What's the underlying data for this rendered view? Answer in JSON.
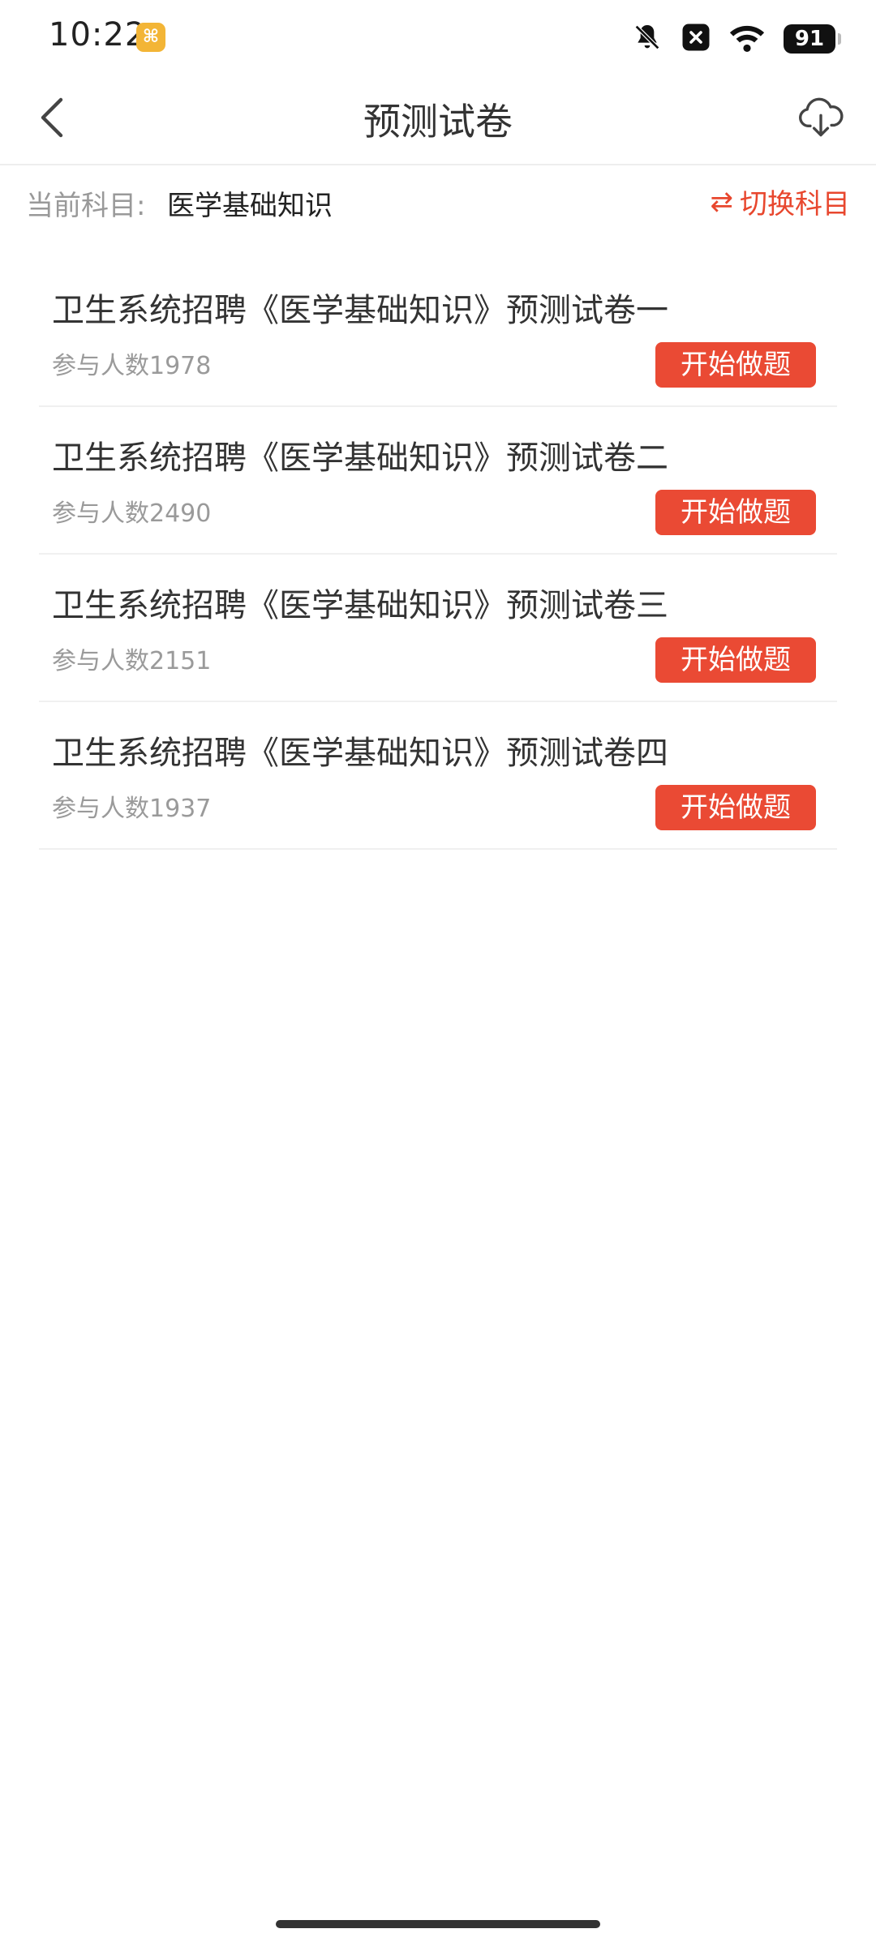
{
  "status_bar": {
    "time": "10:22",
    "app_badge": "⌘",
    "battery": "91"
  },
  "header": {
    "title": "预测试卷"
  },
  "subject": {
    "label": "当前科目:",
    "value": "医学基础知识",
    "switch_label": "切换科目",
    "switch_icon": "⇄"
  },
  "papers": [
    {
      "title": "卫生系统招聘《医学基础知识》预测试卷一",
      "participants": "参与人数1978",
      "button": "开始做题"
    },
    {
      "title": "卫生系统招聘《医学基础知识》预测试卷二",
      "participants": "参与人数2490",
      "button": "开始做题"
    },
    {
      "title": "卫生系统招聘《医学基础知识》预测试卷三",
      "participants": "参与人数2151",
      "button": "开始做题"
    },
    {
      "title": "卫生系统招聘《医学基础知识》预测试卷四",
      "participants": "参与人数1937",
      "button": "开始做题"
    }
  ],
  "colors": {
    "accent": "#ea4a34",
    "muted_text": "#999999",
    "primary_text": "#333333"
  }
}
